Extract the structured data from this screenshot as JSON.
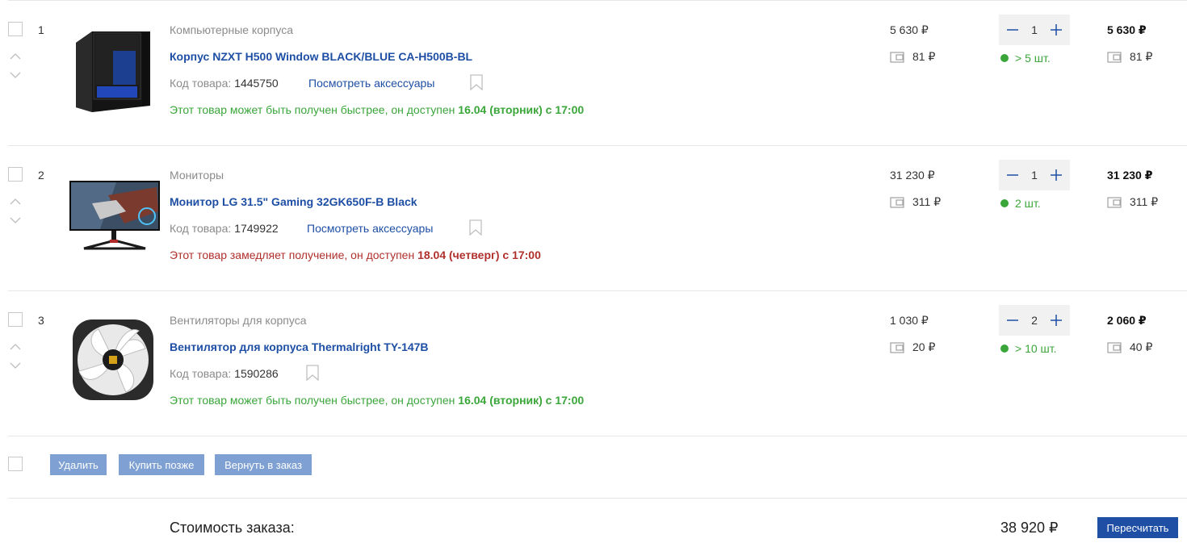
{
  "labels": {
    "code": "Код товара:",
    "accessories": "Посмотреть аксессуары",
    "currency": "₽"
  },
  "items": [
    {
      "index": "1",
      "category": "Компьютерные корпуса",
      "name": "Корпус NZXT H500 Window BLACK/BLUE CA-H500B-BL",
      "code": "1445750",
      "has_accessories": true,
      "availability_text": "Этот товар может быть получен быстрее, он доступен ",
      "availability_date": "16.04 (вторник) с 17:00",
      "availability_status": "green",
      "price": "5 630 ₽",
      "bonus": "81 ₽",
      "quantity": "1",
      "stock": "> 5 шт.",
      "total": "5 630 ₽",
      "total_bonus": "81 ₽",
      "image": "pc-case-image"
    },
    {
      "index": "2",
      "category": "Мониторы",
      "name": "Монитор LG 31.5\" Gaming 32GK650F-B Black",
      "code": "1749922",
      "has_accessories": true,
      "availability_text": "Этот товар замедляет получение, он доступен ",
      "availability_date": "18.04 (четверг) с 17:00",
      "availability_status": "red",
      "price": "31 230 ₽",
      "bonus": "311 ₽",
      "quantity": "1",
      "stock": "2 шт.",
      "total": "31 230 ₽",
      "total_bonus": "311 ₽",
      "image": "monitor-image"
    },
    {
      "index": "3",
      "category": "Вентиляторы для корпуса",
      "name": "Вентилятор для корпуса Thermalright TY-147B",
      "code": "1590286",
      "has_accessories": false,
      "availability_text": "Этот товар может быть получен быстрее, он доступен ",
      "availability_date": "16.04 (вторник) с 17:00",
      "availability_status": "green",
      "price": "1 030 ₽",
      "bonus": "20 ₽",
      "quantity": "2",
      "stock": "> 10 шт.",
      "total": "2 060 ₽",
      "total_bonus": "40 ₽",
      "image": "fan-image"
    }
  ],
  "actions": {
    "delete": "Удалить",
    "buy_later": "Купить позже",
    "return_to_order": "Вернуть в заказ"
  },
  "summary": {
    "label": "Стоимость заказа:",
    "value": "38 920 ₽",
    "recalc": "Пересчитать"
  },
  "colors": {
    "link": "#1e4fa5",
    "green": "#3aa63a",
    "red": "#b0302c",
    "action_button": "#7ea0d3",
    "primary_button": "#1e4fa5"
  }
}
